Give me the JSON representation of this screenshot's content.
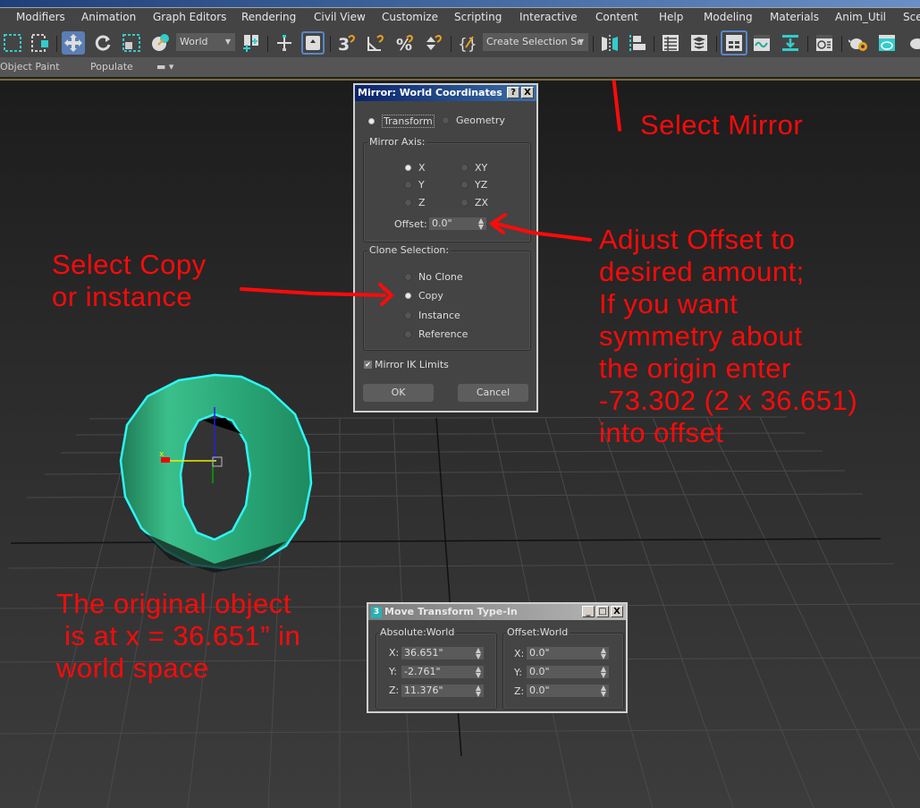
{
  "menubar": {
    "items": [
      "Modifiers",
      "Animation",
      "Graph Editors",
      "Rendering",
      "Civil View",
      "Customize",
      "Scripting",
      "Interactive",
      "Content",
      "Help",
      "Modeling",
      "Materials",
      "Anim_Util",
      "Sce"
    ]
  },
  "toolbar": {
    "reference_coord": "World",
    "selection_set_placeholder": "Create Selection Se",
    "icons": [
      "rect-select-icon",
      "window-crossing-icon",
      "move-icon",
      "rotate-icon",
      "scale-icon",
      "place-icon",
      "pivot-center-icon",
      "select-manipulate-icon",
      "keyboard-shortcut-icon",
      "snap-3d-icon",
      "angle-snap-icon",
      "percent-snap-icon",
      "spinner-snap-icon",
      "edit-named-sets-icon",
      "mirror-icon",
      "align-icon",
      "scene-explorer-icon",
      "layer-explorer-icon",
      "ribbon-toggle-icon",
      "curve-editor-icon",
      "schematic-icon",
      "material-editor-icon",
      "render-setup-icon",
      "rendered-frame-icon",
      "render-icon"
    ]
  },
  "ribbon": {
    "items": [
      "Object Paint",
      "Populate"
    ]
  },
  "mirror_dialog": {
    "title": "Mirror: World Coordinates",
    "help_btn": "?",
    "close_btn": "X",
    "mode_options": [
      {
        "label": "Transform",
        "selected": true
      },
      {
        "label": "Geometry",
        "selected": false
      }
    ],
    "mirror_axis_label": "Mirror Axis:",
    "axes": [
      {
        "label": "X",
        "selected": true
      },
      {
        "label": "XY",
        "selected": false
      },
      {
        "label": "Y",
        "selected": false
      },
      {
        "label": "YZ",
        "selected": false
      },
      {
        "label": "Z",
        "selected": false
      },
      {
        "label": "ZX",
        "selected": false
      }
    ],
    "offset_label": "Offset:",
    "offset_value": "0.0\"",
    "clone_label": "Clone Selection:",
    "clone_options": [
      {
        "label": "No Clone",
        "selected": false
      },
      {
        "label": "Copy",
        "selected": true
      },
      {
        "label": "Instance",
        "selected": false
      },
      {
        "label": "Reference",
        "selected": false
      }
    ],
    "ik_limits_label": "Mirror IK Limits",
    "ik_limits_checked": true,
    "ok_label": "OK",
    "cancel_label": "Cancel"
  },
  "move_dialog": {
    "title": "Move Transform Type-In",
    "absolute_label": "Absolute:World",
    "offset_label": "Offset:World",
    "absolute": [
      {
        "axis": "X:",
        "value": "36.651\""
      },
      {
        "axis": "Y:",
        "value": "-2.761\""
      },
      {
        "axis": "Z:",
        "value": "11.376\""
      }
    ],
    "offset": [
      {
        "axis": "X:",
        "value": "0.0\""
      },
      {
        "axis": "Y:",
        "value": "0.0\""
      },
      {
        "axis": "Z:",
        "value": "0.0\""
      }
    ]
  },
  "annotations": {
    "select_mirror": "Select Mirror",
    "select_copy": "Select Copy\nor instance",
    "adjust_offset": "Adjust Offset to\ndesired amount;\nIf you want\nsymmetry about\nthe origin enter\n-73.302 (2 x 36.651)\ninto offset",
    "original_object": "The original object\n is at x = 36.651” in\nworld space"
  },
  "viewport": {
    "gizmo_axis_label": "x",
    "object_color": "#3bbf8a",
    "selection_color": "#2ef5f5"
  }
}
